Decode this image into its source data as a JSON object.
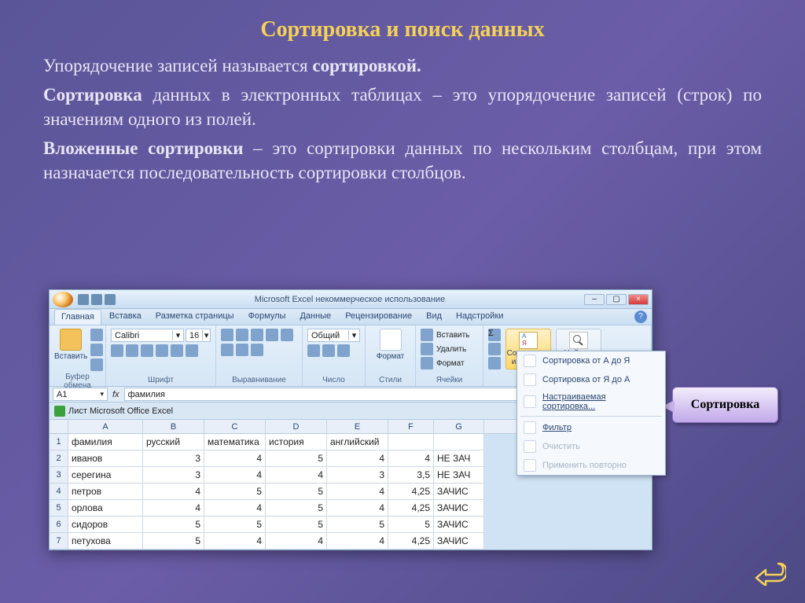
{
  "slide": {
    "title": "Сортировка и поиск данных",
    "para1_a": "Упорядочение записей называется ",
    "para1_b": "сортировкой.",
    "para2_a": "Сортировка",
    "para2_b": " данных в электронных таблицах – это упорядочение записей (строк) по значениям одного из полей.",
    "para3_a": "Вложенные сортировки",
    "para3_b": " – это сортировки данных по нескольким столбцам, при этом назначается последовательность сортировки столбцов."
  },
  "callout": {
    "label": "Сортировка"
  },
  "excel": {
    "title": "Microsoft Excel некоммерческое использование",
    "tabs": [
      "Главная",
      "Вставка",
      "Разметка страницы",
      "Формулы",
      "Данные",
      "Рецензирование",
      "Вид",
      "Надстройки"
    ],
    "groups": {
      "clipboard": {
        "paste": "Вставить",
        "label": "Буфер обмена"
      },
      "font": {
        "name": "Calibri",
        "size": "16",
        "label": "Шрифт"
      },
      "align": {
        "label": "Выравнивание"
      },
      "number": {
        "sel": "Общий",
        "label": "Число"
      },
      "styles": {
        "format": "Формат",
        "label": "Стили"
      },
      "cells": {
        "insert": "Вставить",
        "delete": "Удалить",
        "format": "Формат",
        "label": "Ячейки"
      },
      "editing": {
        "sort": "Сортировка\nи фильтр",
        "find": "Найти и\nвыделить"
      }
    },
    "namebox": "A1",
    "formula": "фамилия",
    "workbook_tab": "Лист Microsoft Office Excel",
    "columns": [
      "",
      "A",
      "B",
      "C",
      "D",
      "E",
      "F",
      "G"
    ],
    "rows": [
      {
        "n": "1",
        "A": "фамилия",
        "B": "русский",
        "C": "математика",
        "D": "история",
        "E": "английский",
        "F": "",
        "G": ""
      },
      {
        "n": "2",
        "A": "иванов",
        "B": "3",
        "C": "4",
        "D": "5",
        "E": "4",
        "F": "4",
        "G": "НЕ ЗАЧ"
      },
      {
        "n": "3",
        "A": "серегина",
        "B": "3",
        "C": "4",
        "D": "4",
        "E": "3",
        "F": "3,5",
        "G": "НЕ ЗАЧ"
      },
      {
        "n": "4",
        "A": "петров",
        "B": "4",
        "C": "5",
        "D": "5",
        "E": "4",
        "F": "4,25",
        "G": "ЗАЧИС"
      },
      {
        "n": "5",
        "A": "орлова",
        "B": "4",
        "C": "4",
        "D": "5",
        "E": "4",
        "F": "4,25",
        "G": "ЗАЧИС"
      },
      {
        "n": "6",
        "A": "сидоров",
        "B": "5",
        "C": "5",
        "D": "5",
        "E": "5",
        "F": "5",
        "G": "ЗАЧИС"
      },
      {
        "n": "7",
        "A": "петухова",
        "B": "5",
        "C": "4",
        "D": "4",
        "E": "4",
        "F": "4,25",
        "G": "ЗАЧИС"
      }
    ],
    "menu": {
      "az": "Сортировка от А до Я",
      "za": "Сортировка от Я до А",
      "custom": "Настраиваемая сортировка...",
      "filter": "Фильтр",
      "clear": "Очистить",
      "reapply": "Применить повторно"
    }
  }
}
